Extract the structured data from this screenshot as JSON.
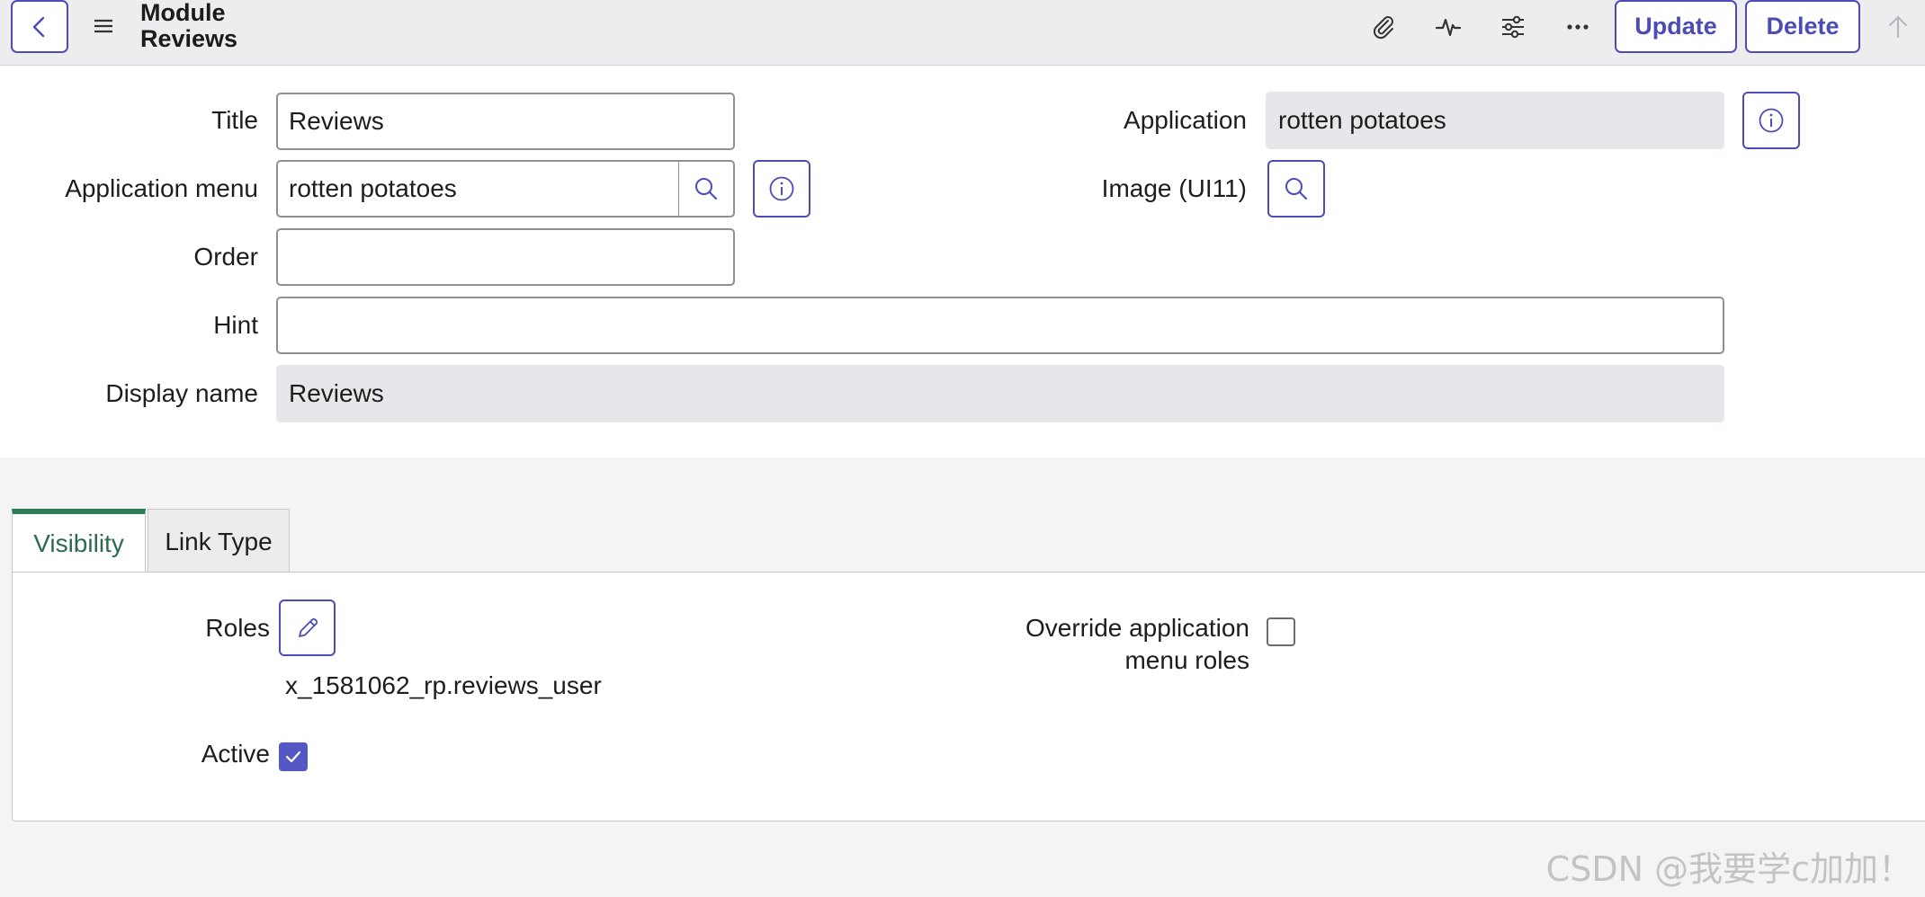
{
  "header": {
    "title_line1": "Module",
    "title_line2": "Reviews",
    "update_label": "Update",
    "delete_label": "Delete"
  },
  "form": {
    "title": {
      "label": "Title",
      "value": "Reviews"
    },
    "application": {
      "label": "Application",
      "value": "rotten potatoes"
    },
    "application_menu": {
      "label": "Application menu",
      "value": "rotten potatoes"
    },
    "image": {
      "label": "Image (UI11)"
    },
    "order": {
      "label": "Order",
      "value": ""
    },
    "hint": {
      "label": "Hint",
      "value": ""
    },
    "display_name": {
      "label": "Display name",
      "value": "Reviews"
    }
  },
  "tabs": [
    {
      "label": "Visibility",
      "active": true
    },
    {
      "label": "Link Type",
      "active": false
    }
  ],
  "visibility": {
    "roles_label": "Roles",
    "roles_value": "x_1581062_rp.reviews_user",
    "override_label_line1": "Override application",
    "override_label_line2": "menu roles",
    "override_checked": false,
    "active_label": "Active",
    "active_checked": true
  },
  "colors": {
    "accent": "#4b4cb5",
    "tab_active": "#2e7d5b",
    "checkbox_checked": "#5557c3"
  },
  "icons": [
    "back-icon",
    "menu-icon",
    "paperclip-icon",
    "activity-icon",
    "sliders-icon",
    "more-icon",
    "arrow-up-icon",
    "info-icon",
    "search-icon",
    "pencil-icon",
    "check-icon"
  ],
  "watermark": "CSDN @我要学c加加！"
}
